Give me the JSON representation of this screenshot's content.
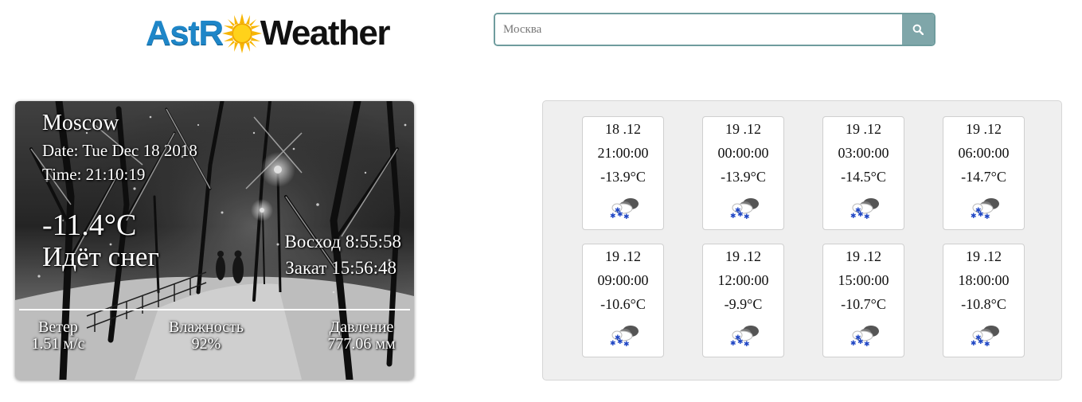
{
  "logo": {
    "part1": "AstR",
    "part2": "Weather",
    "icon": "sun-icon"
  },
  "search": {
    "value": "Москва",
    "icon": "search-icon"
  },
  "current": {
    "city": "Moscow",
    "date": "Date: Tue Dec 18 2018",
    "time": "Time: 21:10:19",
    "temperature": "-11.4°C",
    "condition": "Идёт снег",
    "sunrise": "Восход 8:55:58",
    "sunset": "Закат 15:56:48",
    "wind": {
      "label": "Ветер",
      "value": "1.51 м/с"
    },
    "humidity": {
      "label": "Влажность",
      "value": "92%"
    },
    "pressure": {
      "label": "Давление",
      "value": "777.06 мм"
    }
  },
  "forecast": [
    {
      "date": "18 .12",
      "time": "21:00:00",
      "temp": "-13.9°C",
      "icon": "snow-cloud-icon"
    },
    {
      "date": "19 .12",
      "time": "00:00:00",
      "temp": "-13.9°C",
      "icon": "snow-cloud-icon"
    },
    {
      "date": "19 .12",
      "time": "03:00:00",
      "temp": "-14.5°C",
      "icon": "snow-cloud-icon"
    },
    {
      "date": "19 .12",
      "time": "06:00:00",
      "temp": "-14.7°C",
      "icon": "snow-cloud-icon"
    },
    {
      "date": "19 .12",
      "time": "09:00:00",
      "temp": "-10.6°C",
      "icon": "snow-cloud-icon"
    },
    {
      "date": "19 .12",
      "time": "12:00:00",
      "temp": "-9.9°C",
      "icon": "snow-cloud-icon"
    },
    {
      "date": "19 .12",
      "time": "15:00:00",
      "temp": "-10.7°C",
      "icon": "snow-cloud-icon"
    },
    {
      "date": "19 .12",
      "time": "18:00:00",
      "temp": "-10.8°C",
      "icon": "snow-cloud-icon"
    }
  ],
  "colors": {
    "logo_blue": "#1e86c8",
    "search_border": "#6f9c9e",
    "search_button": "#7fa6a9",
    "panel_bg": "#efefef"
  }
}
